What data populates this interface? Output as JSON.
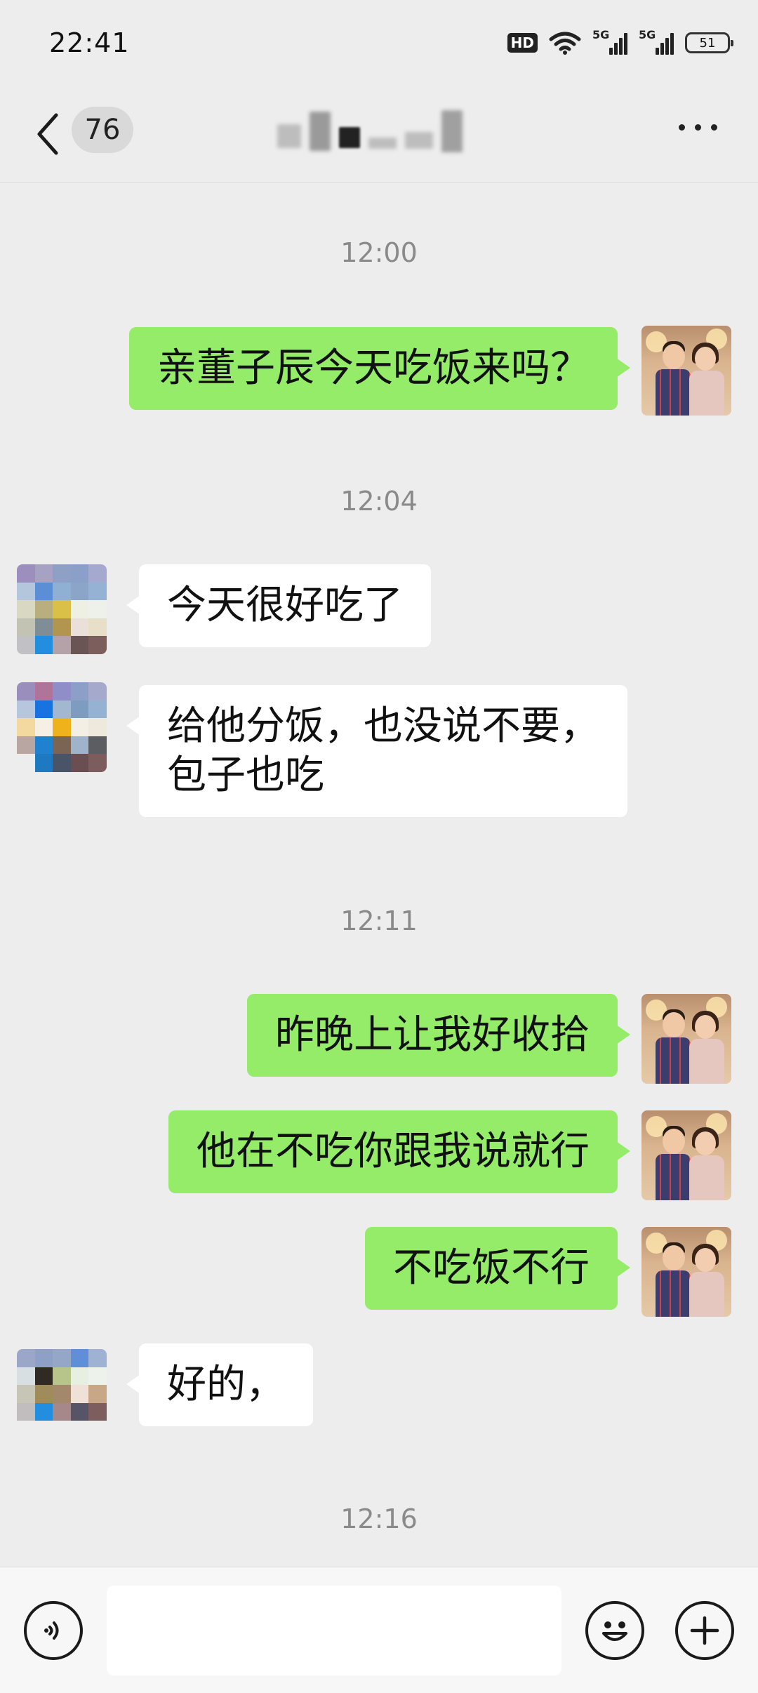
{
  "status_bar": {
    "time": "22:41",
    "hd_label": "HD",
    "net1_label": "5G",
    "net2_label": "5G",
    "battery": "51"
  },
  "header": {
    "back_icon": "chevron-left-icon",
    "unread_count": "76",
    "more_icon": "more-dots-icon"
  },
  "chat": {
    "timestamps": [
      "12:00",
      "12:04",
      "12:11",
      "12:16"
    ],
    "messages": [
      {
        "sender": "me",
        "text": "亲董子辰今天吃饭来吗？"
      },
      {
        "sender": "them",
        "text": "今天很好吃了"
      },
      {
        "sender": "them",
        "text": "给他分饭，也没说不要，\n包子也吃"
      },
      {
        "sender": "me",
        "text": "昨晚上让我好收拾"
      },
      {
        "sender": "me",
        "text": "他在不吃你跟我说就行"
      },
      {
        "sender": "me",
        "text": "不吃饭不行"
      },
      {
        "sender": "them",
        "text": "好的，"
      }
    ]
  },
  "input_bar": {
    "voice_icon": "voice-icon",
    "text_value": "",
    "emoji_icon": "emoji-icon",
    "plus_icon": "plus-icon"
  },
  "colors": {
    "background": "#ededed",
    "my_bubble": "#95ec69",
    "their_bubble": "#ffffff",
    "timestamp": "#8a8a8a"
  }
}
